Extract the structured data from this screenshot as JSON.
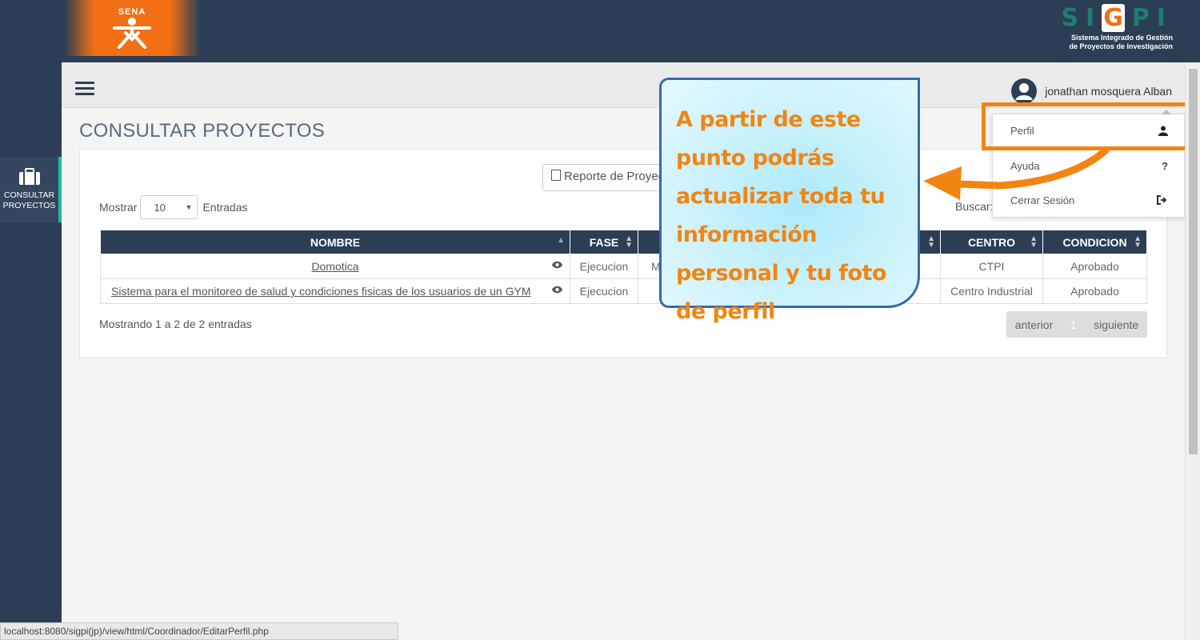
{
  "header": {
    "sena_logo_text": "SENA",
    "sigpi_brand_before": "SI",
    "sigpi_brand_g": "G",
    "sigpi_brand_after": "PI",
    "sigpi_subtitle_line1": "Sistema Integrado de Gestión",
    "sigpi_subtitle_line2": "de Proyectos de Investigación"
  },
  "sidebar": {
    "items": [
      {
        "label_line1": "CONSULTAR",
        "label_line2": "PROYECTOS",
        "icon": "briefcase-icon"
      }
    ]
  },
  "navbar": {
    "user_name": "jonathan mosquera Alban"
  },
  "page": {
    "title": "CONSULTAR PROYECTOS",
    "report_button": "Reporte de Proyectos",
    "show_label": "Mostrar",
    "show_value": "10",
    "entries_label": "Entradas",
    "search_label": "Buscar:"
  },
  "table": {
    "columns": [
      "NOMBRE",
      "FASE",
      "",
      "",
      "CENTRO",
      "CONDICION"
    ],
    "rows": [
      {
        "nombre": "Domotica",
        "fase": "Ejecucion",
        "col3": "M",
        "col4": "",
        "centro": "CTPI",
        "condicion": "Aprobado"
      },
      {
        "nombre": "Sistema para el monitoreo de salud y condiciones fisicas de los usuarios de un GYM",
        "fase": "Ejecucion",
        "col3": "",
        "col4": "",
        "centro": "Centro Industrial",
        "condicion": "Aprobado"
      }
    ]
  },
  "footer": {
    "info": "Mostrando 1 a 2 de 2 entradas",
    "prev": "anterior",
    "page": "1",
    "next": "siguiente"
  },
  "user_menu": {
    "items": [
      {
        "label": "Perfil",
        "icon": "user-icon"
      },
      {
        "label": "Ayuda",
        "icon": "question-icon"
      },
      {
        "label": "Cerrar Sesión",
        "icon": "sign-out-icon"
      }
    ]
  },
  "callout": {
    "message": "A partir de este punto podrás actualizar toda tu información personal y tu foto de perfil"
  },
  "status_bar": {
    "url": "localhost:8080/sigpi(jp)/view/html/Coordinador/EditarPerfil.php"
  },
  "colors": {
    "navy": "#2b3e55",
    "orange": "#f28511",
    "teal": "#1abc9c"
  }
}
